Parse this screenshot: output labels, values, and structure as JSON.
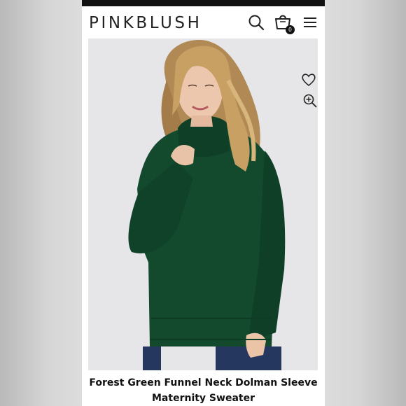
{
  "header": {
    "brand": "PINKBLUSH",
    "cart_count": "0",
    "icons": [
      "search-icon",
      "shopping-bag-icon",
      "hamburger-menu-icon"
    ]
  },
  "product": {
    "title_line1": "Forest Green Funnel Neck Dolman Sleeve",
    "title_line2": "Maternity Sweater",
    "sweater_color": "#134a2e"
  },
  "image_actions": {
    "icons": [
      "heart-icon",
      "zoom-in-icon"
    ]
  }
}
